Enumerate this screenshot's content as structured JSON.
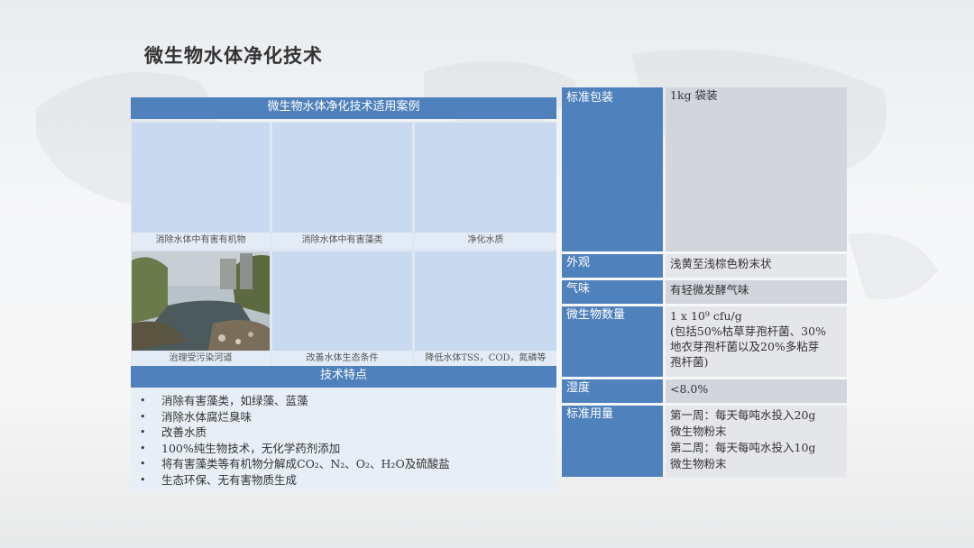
{
  "title": "微生物水体净化技术",
  "cases": {
    "header": "微生物水体净化技术适用案例",
    "cells": [
      {
        "caption": "消除水体中有害有机物"
      },
      {
        "caption": "消除水体中有害藻类"
      },
      {
        "caption": "净化水质"
      },
      {
        "caption": "治理受污染河道"
      },
      {
        "caption": "改善水体生态条件"
      },
      {
        "caption": "降低水体TSS，COD，氮磷等"
      }
    ]
  },
  "features": {
    "header": "技术特点",
    "items": [
      "消除有害藻类，如绿藻、蓝藻",
      "消除水体腐烂臭味",
      "改善水质",
      "100%纯生物技术，无化学药剂添加",
      "将有害藻类等有机物分解成CO₂、N₂、O₂、H₂O及硫酸盐",
      "生态环保、无有害物质生成"
    ],
    "bullet": "•"
  },
  "spec": {
    "rows": [
      {
        "key": "标准包装",
        "lines": [
          "1kg 袋装"
        ]
      },
      {
        "key": "外观",
        "lines": [
          "浅黄至浅棕色粉末状"
        ]
      },
      {
        "key": "气味",
        "lines": [
          "有轻微发酵气味"
        ]
      },
      {
        "key": "微生物数量",
        "lines": [
          "1 x 10⁹ cfu/g",
          "(包括50%枯草芽孢杆菌、30%",
          "地衣芽孢杆菌以及20%多粘芽",
          "孢杆菌)"
        ]
      },
      {
        "key": "湿度",
        "lines": [
          "<8.0%"
        ]
      },
      {
        "key": "标准用量",
        "lines": [
          "第一周：每天每吨水投入20g",
          "微生物粉末",
          "第二周：每天每吨水投入10g",
          "微生物粉末"
        ]
      }
    ]
  },
  "colors": {
    "header_blue": "#4f81bd",
    "cell_blue": "#c9daf0",
    "value_gray": "#d2d6dc"
  }
}
